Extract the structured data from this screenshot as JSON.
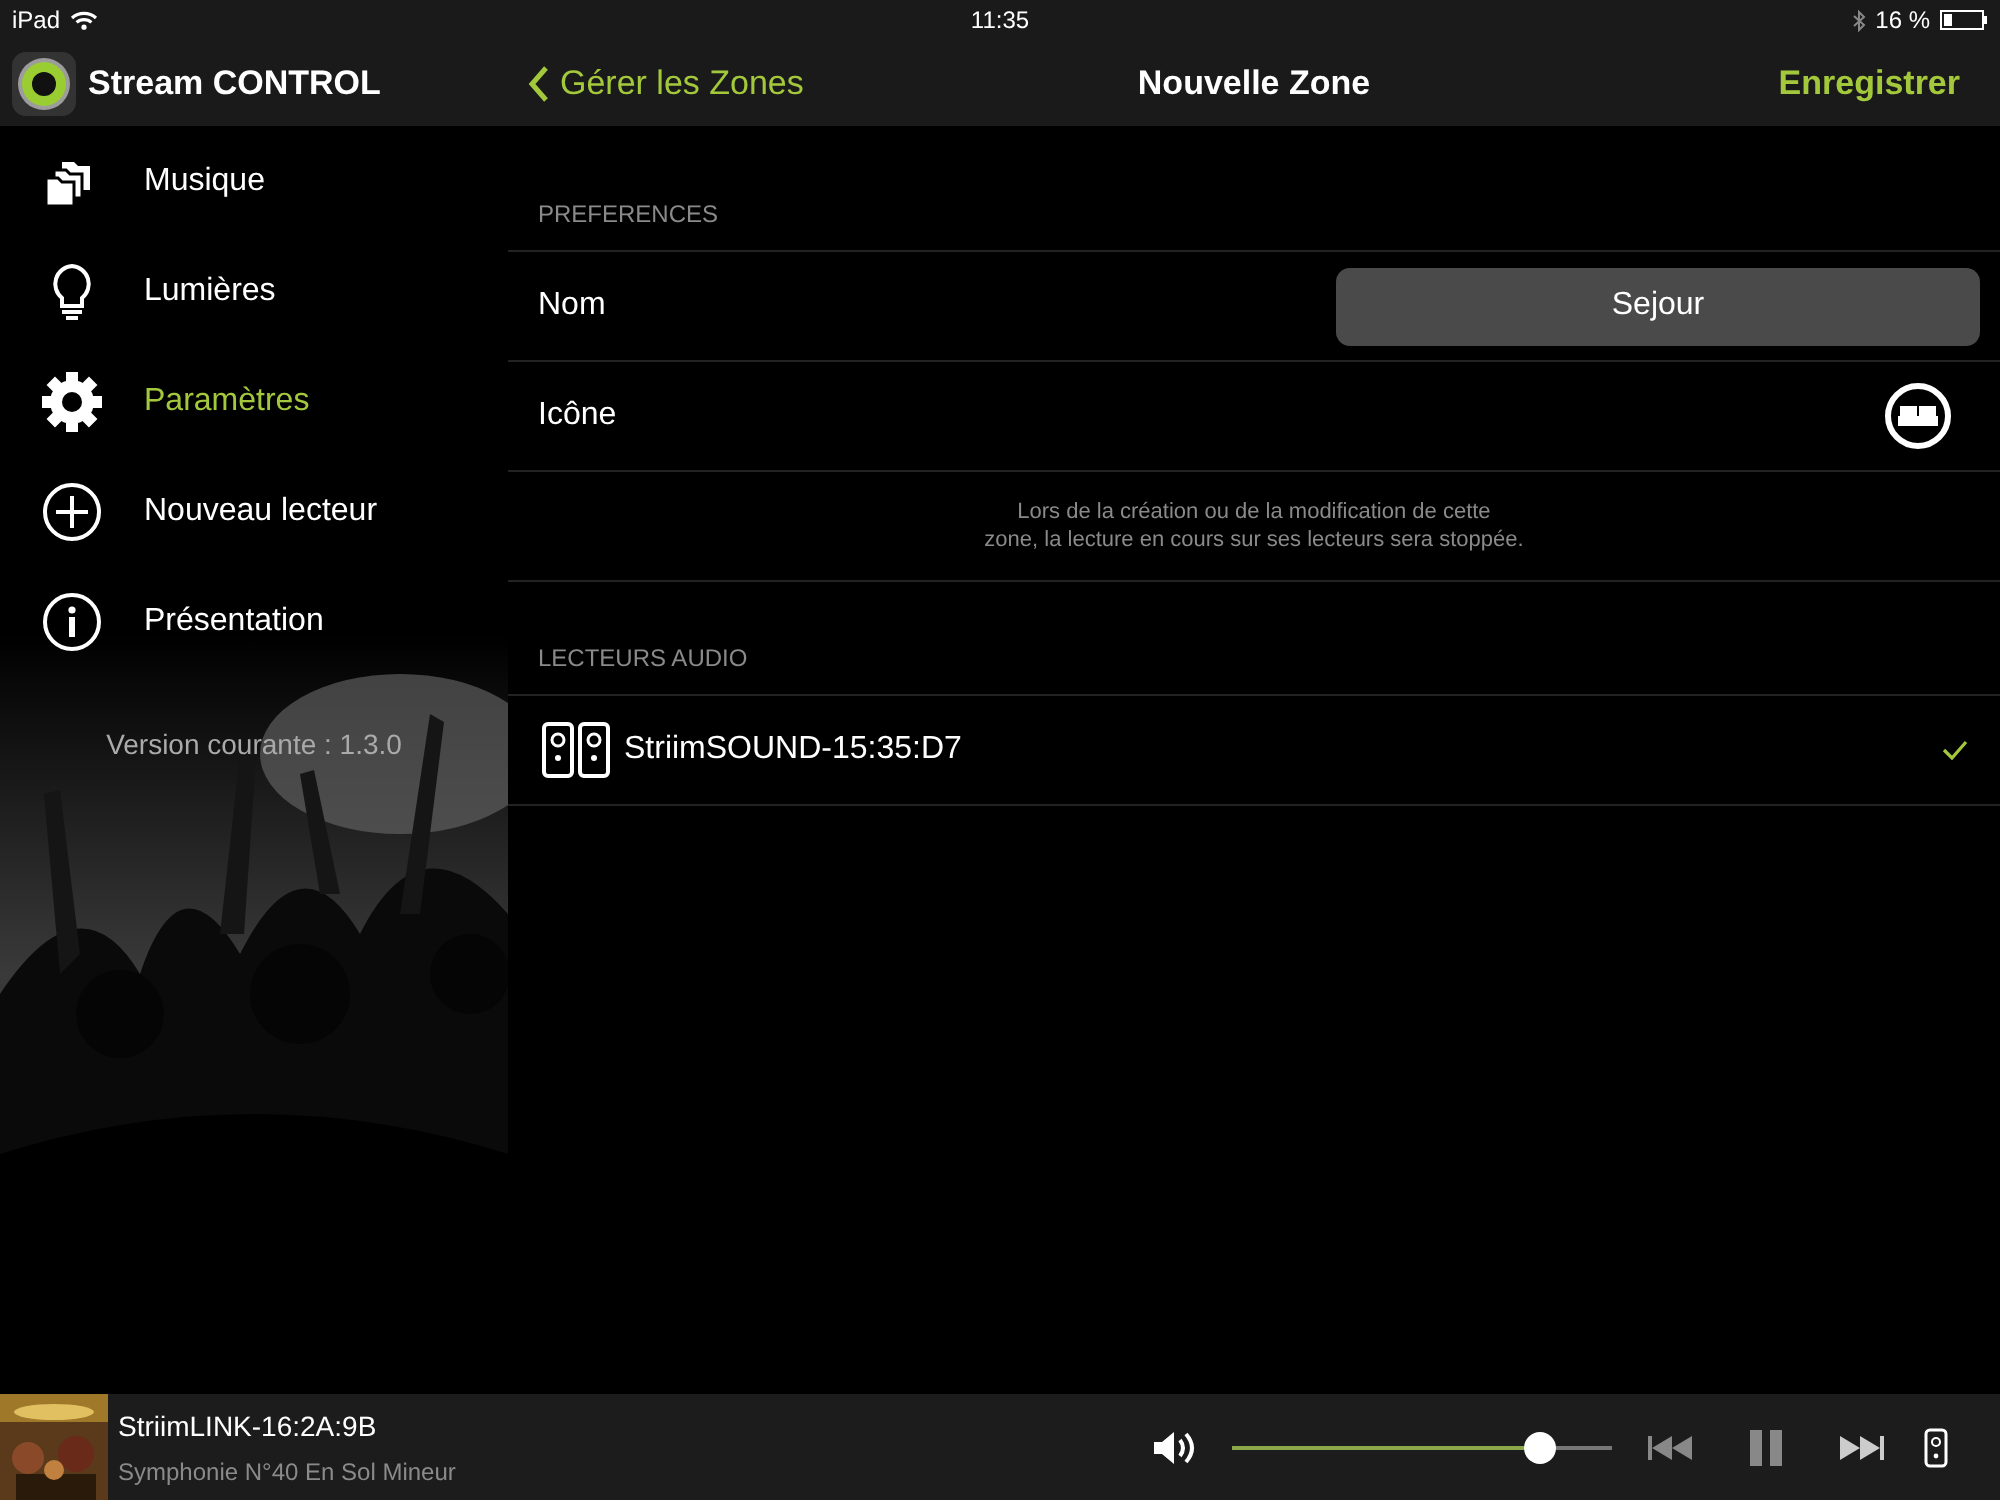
{
  "status_bar": {
    "device": "iPad",
    "time": "11:35",
    "battery": "16 %"
  },
  "sidebar": {
    "app_title": "Stream CONTROL",
    "items": [
      {
        "label": "Musique",
        "kind": "music",
        "selected": false
      },
      {
        "label": "Lumières",
        "kind": "lights",
        "selected": false
      },
      {
        "label": "Paramètres",
        "kind": "settings",
        "selected": true
      },
      {
        "label": "Nouveau lecteur",
        "kind": "add",
        "selected": false
      },
      {
        "label": "Présentation",
        "kind": "info",
        "selected": false
      }
    ],
    "version": "Version courante : 1.3.0"
  },
  "nav": {
    "back": "Gérer les Zones",
    "title": "Nouvelle Zone",
    "action": "Enregistrer"
  },
  "preferences": {
    "header": "PREFERENCES",
    "name_label": "Nom",
    "name_value": "Sejour",
    "icon_label": "Icône",
    "note": "Lors de la création ou de la modification de cette\nzone, la lecture en cours sur ses lecteurs sera stoppée."
  },
  "audio_players": {
    "header": "LECTEURS AUDIO",
    "items": [
      {
        "name": "StriimSOUND-15:35:D7",
        "checked": true
      }
    ]
  },
  "player": {
    "title": "StriimLINK-16:2A:9B",
    "subtitle": "Symphonie N°40 En Sol Mineur",
    "playing": true,
    "volume": {
      "level": 0.81
    }
  }
}
